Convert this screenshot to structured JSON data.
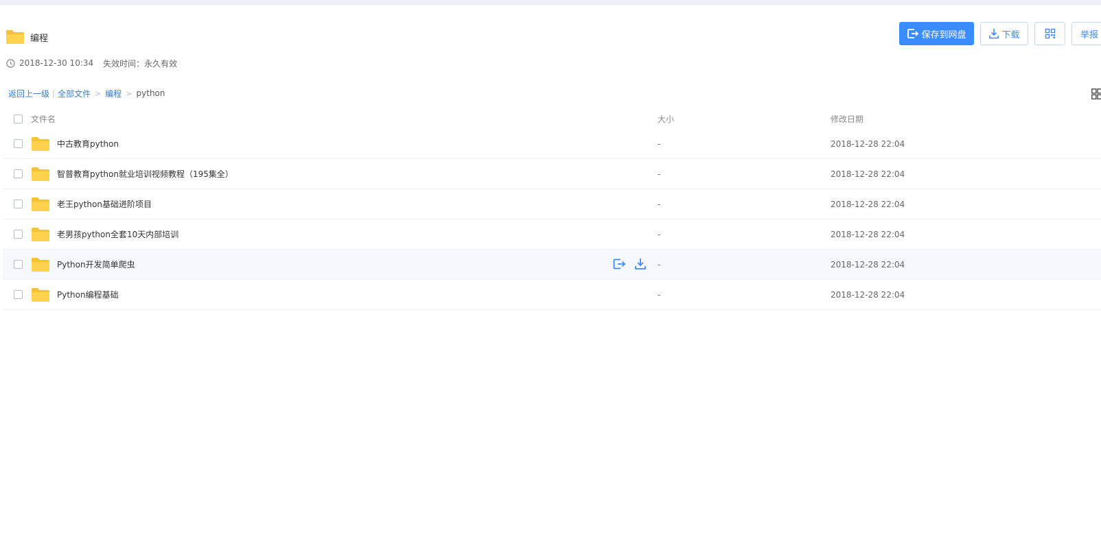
{
  "share": {
    "title": "编程",
    "created": "2018-12-30 10:34",
    "expire": "失效时间：永久有效"
  },
  "actions": {
    "save_label": "保存到网盘",
    "download_label": "下载",
    "report_label": "举报"
  },
  "breadcrumb": {
    "back": "返回上一级",
    "sep": "|",
    "all_files": "全部文件",
    "gt": ">",
    "folder": "编程",
    "current": "python"
  },
  "columns": {
    "name": "文件名",
    "size": "大小",
    "date": "修改日期"
  },
  "files": [
    {
      "name": "中古教育python",
      "size": "-",
      "date": "2018-12-28 22:04"
    },
    {
      "name": "智普教育python就业培训视频教程（195集全）",
      "size": "-",
      "date": "2018-12-28 22:04"
    },
    {
      "name": "老王python基础进阶项目",
      "size": "-",
      "date": "2018-12-28 22:04"
    },
    {
      "name": "老男孩python全套10天内部培训",
      "size": "-",
      "date": "2018-12-28 22:04"
    },
    {
      "name": "Python开发简单爬虫",
      "size": "-",
      "date": "2018-12-28 22:04"
    },
    {
      "name": "Python编程基础",
      "size": "-",
      "date": "2018-12-28 22:04"
    }
  ],
  "colors": {
    "accent": "#3b8cff",
    "folder": "#ffd24d",
    "link": "#3b7cc4"
  }
}
